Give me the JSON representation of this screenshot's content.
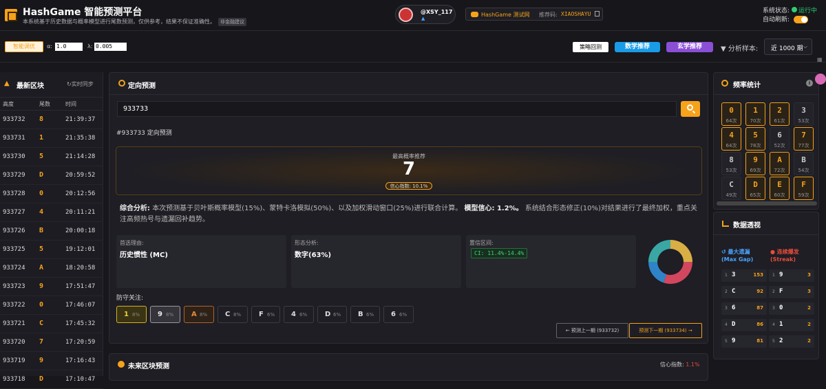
{
  "header": {
    "title": "HashGame 智能预测平台",
    "subtitle": "本系统基于历史数据与概率模型进行尾数预测，仅供参考，结果不保证准确性。",
    "badge": "非金融建议",
    "user": "@XSY_117",
    "site_name": "HashGame 测试网",
    "ref_label": "推荐码:",
    "ref_code": "XIAOSHAYU",
    "status_label": "系统状态:",
    "status_value": "运行中",
    "auto_refresh_label": "自动刷新:"
  },
  "toolbar": {
    "smart_button": "智能调优",
    "alpha_label": "α:",
    "alpha_value": "1.0",
    "lambda_label": "λ:",
    "lambda_value": "0.005",
    "strategy_button": "策略回测",
    "math_button": "数学推荐",
    "meta_button": "玄学推荐",
    "sample_label": "分析样本:",
    "sample_value": "近 1000 期",
    "toggle_on": true
  },
  "blocks": {
    "title": "最新区块",
    "sync": "实时同步",
    "headers": [
      "高度",
      "尾数",
      "时间"
    ],
    "rows": [
      {
        "height": "933732",
        "tail": "8",
        "time": "21:39:37"
      },
      {
        "height": "933731",
        "tail": "1",
        "time": "21:35:38"
      },
      {
        "height": "933730",
        "tail": "5",
        "time": "21:14:28"
      },
      {
        "height": "933729",
        "tail": "D",
        "time": "20:59:52"
      },
      {
        "height": "933728",
        "tail": "0",
        "time": "20:12:56"
      },
      {
        "height": "933727",
        "tail": "4",
        "time": "20:11:21"
      },
      {
        "height": "933726",
        "tail": "B",
        "time": "20:00:18"
      },
      {
        "height": "933725",
        "tail": "5",
        "time": "19:12:01"
      },
      {
        "height": "933724",
        "tail": "A",
        "time": "18:20:58"
      },
      {
        "height": "933723",
        "tail": "9",
        "time": "17:51:47"
      },
      {
        "height": "933722",
        "tail": "0",
        "time": "17:46:07"
      },
      {
        "height": "933721",
        "tail": "C",
        "time": "17:45:32"
      },
      {
        "height": "933720",
        "tail": "7",
        "time": "17:20:59"
      },
      {
        "height": "933719",
        "tail": "9",
        "time": "17:16:43"
      },
      {
        "height": "933718",
        "tail": "D",
        "time": "17:10:47"
      }
    ]
  },
  "predict": {
    "title": "定向预测",
    "search_value": "933733",
    "heading": "#933733 定向预测",
    "top_label": "最高概率推荐",
    "top_value": "7",
    "confidence": "信心指数: 10.1%",
    "analysis_head": "综合分析:",
    "analysis_body": "本次预测基于贝叶斯概率模型(15%)、蒙特卡洛模拟(50%)、以及加权滑动窗口(25%)进行联合计算。",
    "model_conf_head": "模型信心: 1.2%。",
    "analysis_tail": "系统结合形态修正(10%)对结果进行了最终加权，重点关注高频热号与遗漏回补趋势。",
    "card1_label": "首选理由:",
    "card1_value": "历史惯性 (MC)",
    "card2_label": "形态分析:",
    "card2_value": "数字(63%)",
    "card3_label": "置信区间:",
    "card3_value": "CI: 11.4%-14.4%",
    "donut": [
      {
        "value": 25,
        "color": "#d8ae45"
      },
      {
        "value": 30,
        "color": "#d2475e"
      },
      {
        "value": 20,
        "color": "#2f84c8"
      },
      {
        "value": 25,
        "color": "#3aa7a4"
      }
    ],
    "defense_title": "防守关注:",
    "defense": [
      {
        "key": "1",
        "pct": "8%",
        "style": "gold"
      },
      {
        "key": "9",
        "pct": "8%",
        "style": "silver"
      },
      {
        "key": "A",
        "pct": "8%",
        "style": "bronze"
      },
      {
        "key": "C",
        "pct": "8%",
        "style": "plain"
      },
      {
        "key": "F",
        "pct": "6%",
        "style": "plain"
      },
      {
        "key": "4",
        "pct": "6%",
        "style": "plain"
      },
      {
        "key": "D",
        "pct": "6%",
        "style": "plain"
      },
      {
        "key": "B",
        "pct": "6%",
        "style": "plain"
      },
      {
        "key": "6",
        "pct": "6%",
        "style": "plain"
      }
    ],
    "prev_button": "← 预测上一期 (933732)",
    "next_button": "预测下一期 (933734) →"
  },
  "future": {
    "title": "未来区块预测",
    "conf_label": "信心指数:",
    "conf_value": "1.1%"
  },
  "freq": {
    "title": "频率统计",
    "cells": [
      {
        "key": "0",
        "count": "64次",
        "hot": true
      },
      {
        "key": "1",
        "count": "70次",
        "hot": true
      },
      {
        "key": "2",
        "count": "61次",
        "hot": true
      },
      {
        "key": "3",
        "count": "53次",
        "hot": false
      },
      {
        "key": "4",
        "count": "64次",
        "hot": true
      },
      {
        "key": "5",
        "count": "78次",
        "hot": true
      },
      {
        "key": "6",
        "count": "52次",
        "hot": false
      },
      {
        "key": "7",
        "count": "77次",
        "hot": true
      },
      {
        "key": "8",
        "count": "53次",
        "hot": false
      },
      {
        "key": "9",
        "count": "69次",
        "hot": true
      },
      {
        "key": "A",
        "count": "72次",
        "hot": true
      },
      {
        "key": "B",
        "count": "54次",
        "hot": false
      },
      {
        "key": "C",
        "count": "49次",
        "hot": false
      },
      {
        "key": "D",
        "count": "65次",
        "hot": true
      },
      {
        "key": "E",
        "count": "60次",
        "hot": true
      },
      {
        "key": "F",
        "count": "59次",
        "hot": true
      }
    ]
  },
  "perspective": {
    "title": "数据透视",
    "gap_title": "最大遗漏",
    "gap_sub": "(Max Gap)",
    "streak_title": "连续爆发",
    "streak_sub": "(Streak)",
    "gap": [
      {
        "rank": "1",
        "key": "3",
        "val": "153"
      },
      {
        "rank": "2",
        "key": "C",
        "val": "92"
      },
      {
        "rank": "3",
        "key": "6",
        "val": "87"
      },
      {
        "rank": "4",
        "key": "D",
        "val": "86"
      },
      {
        "rank": "5",
        "key": "9",
        "val": "81"
      }
    ],
    "streak": [
      {
        "rank": "1",
        "key": "9",
        "val": "3"
      },
      {
        "rank": "2",
        "key": "F",
        "val": "3"
      },
      {
        "rank": "3",
        "key": "0",
        "val": "2"
      },
      {
        "rank": "4",
        "key": "1",
        "val": "2"
      },
      {
        "rank": "5",
        "key": "2",
        "val": "2"
      }
    ]
  }
}
